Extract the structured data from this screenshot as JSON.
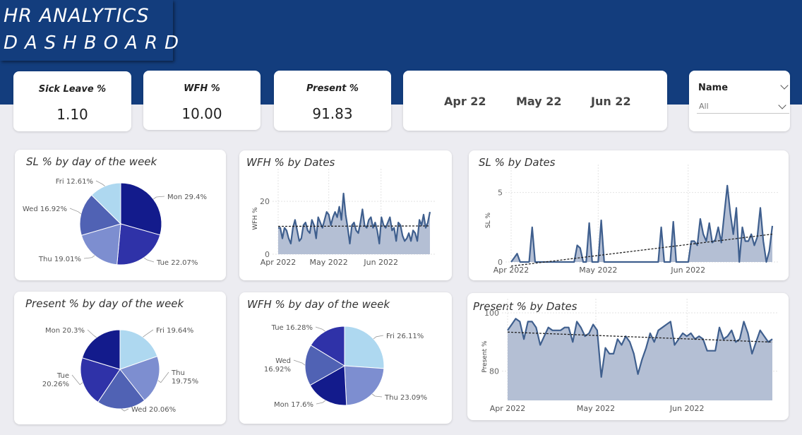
{
  "header": {
    "title_line1": "HR  ANALYTICS",
    "title_line2": "DASHBOARD"
  },
  "kpis": [
    {
      "label": "Sick Leave %",
      "value": "1.10"
    },
    {
      "label": "WFH %",
      "value": "10.00"
    },
    {
      "label": "Present %",
      "value": "91.83"
    }
  ],
  "months": [
    "Apr 22",
    "May 22",
    "Jun 22"
  ],
  "slicer": {
    "title": "Name",
    "value": "All"
  },
  "colors": {
    "header": "#133d7d",
    "line": "#3f5f8e",
    "area": "#b4bfd4",
    "pie": [
      "#131b8c",
      "#2f32a8",
      "#5062b4",
      "#7d8ed0",
      "#aed8f0"
    ]
  },
  "chart_data": [
    {
      "id": "sl-dow",
      "type": "pie",
      "title": "SL % by day of the week",
      "slices": [
        {
          "label": "Mon",
          "value": 29.4,
          "text": "Mon 29.4%"
        },
        {
          "label": "Tue",
          "value": 22.07,
          "text": "Tue 22.07%"
        },
        {
          "label": "Thu",
          "value": 19.01,
          "text": "Thu 19.01%"
        },
        {
          "label": "Wed",
          "value": 16.92,
          "text": "Wed 16.92%"
        },
        {
          "label": "Fri",
          "value": 12.61,
          "text": "Fri 12.61%"
        }
      ]
    },
    {
      "id": "wfh-dates",
      "type": "area",
      "title": "WFH % by Dates",
      "ylabel": "WFH %",
      "ylim": [
        0,
        27
      ],
      "yticks": [
        0,
        20
      ],
      "xticks": [
        "Apr 2022",
        "May 2022",
        "Jun 2022"
      ],
      "x_start": "2022-04-01",
      "x_end": "2022-06-30",
      "trendline": true,
      "values": [
        10,
        10,
        6,
        10,
        9,
        6,
        4,
        10,
        13,
        9,
        5,
        6,
        11,
        12,
        9,
        8,
        13,
        11,
        6,
        14,
        12,
        10,
        13,
        16,
        15,
        11,
        14,
        16,
        14,
        18,
        13,
        23,
        15,
        10,
        4,
        11,
        12,
        9,
        8,
        12,
        17,
        11,
        10,
        13,
        14,
        10,
        12,
        9,
        4,
        14,
        11,
        10,
        12,
        14,
        9,
        10,
        5,
        12,
        11,
        7,
        5,
        6,
        8,
        5,
        9,
        8,
        5,
        13,
        11,
        15,
        10,
        12,
        16
      ]
    },
    {
      "id": "sl-dates",
      "type": "area",
      "title": "SL % by Dates",
      "ylabel": "SL %",
      "ylim": [
        0,
        6
      ],
      "yticks": [
        0,
        5
      ],
      "xticks": [
        "Apr 2022",
        "May 2022",
        "Jun 2022"
      ],
      "x_start": "2022-04-01",
      "x_end": "2022-06-30",
      "trendline": true,
      "values": [
        0,
        0.3,
        0.6,
        0,
        0,
        0,
        0,
        2.5,
        0,
        0,
        0,
        0,
        0,
        0,
        0,
        0,
        0,
        0,
        0,
        0,
        0,
        0,
        1.2,
        1.0,
        0,
        0,
        2.8,
        0,
        0,
        0,
        3.0,
        0,
        0,
        0,
        0,
        0,
        0,
        0,
        0,
        0,
        0,
        0,
        0,
        0,
        0,
        0,
        0,
        0,
        0,
        0,
        2.5,
        0,
        0,
        0,
        2.9,
        0,
        0,
        0,
        0,
        0,
        1.5,
        1.5,
        1.2,
        3.1,
        2.0,
        1.5,
        2.8,
        1.4,
        1.6,
        2.5,
        1.4,
        3.5,
        5.5,
        3.5,
        2.0,
        3.9,
        0,
        2.5,
        1.5,
        1.5,
        2.0,
        1.2,
        1.8,
        3.9,
        1.5,
        0,
        0.8,
        2.6
      ]
    },
    {
      "id": "present-dow",
      "type": "pie",
      "title": "Present % by day of the week",
      "slices": [
        {
          "label": "Fri",
          "value": 19.64,
          "text": "Fri 19.64%"
        },
        {
          "label": "Thu",
          "value": 19.75,
          "text": [
            "Thu",
            "19.75%"
          ]
        },
        {
          "label": "Wed",
          "value": 20.06,
          "text": "Wed 20.06%"
        },
        {
          "label": "Tue",
          "value": 20.26,
          "text": [
            "Tue",
            "20.26%"
          ]
        },
        {
          "label": "Mon",
          "value": 20.3,
          "text": "Mon 20.3%"
        }
      ]
    },
    {
      "id": "wfh-dow",
      "type": "pie",
      "title": "WFH % by day of the week",
      "slices": [
        {
          "label": "Fri",
          "value": 26.11,
          "text": "Fri 26.11%"
        },
        {
          "label": "Thu",
          "value": 23.09,
          "text": "Thu 23.09%"
        },
        {
          "label": "Mon",
          "value": 17.6,
          "text": "Mon 17.6%"
        },
        {
          "label": "Wed",
          "value": 16.92,
          "text": [
            "Wed",
            "16.92%"
          ]
        },
        {
          "label": "Tue",
          "value": 16.28,
          "text": "Tue 16.28%"
        }
      ]
    },
    {
      "id": "present-dates",
      "type": "area",
      "title": "Present % by Dates",
      "ylabel": "Present %",
      "ylim": [
        70,
        100
      ],
      "yticks": [
        80,
        100
      ],
      "xticks": [
        "Apr 2022",
        "May 2022",
        "Jun 2022"
      ],
      "x_start": "2022-04-01",
      "x_end": "2022-06-30",
      "trendline": true,
      "values": [
        94,
        96,
        98,
        97,
        91,
        97,
        97,
        95,
        89,
        92,
        95,
        94,
        94,
        94,
        95,
        95,
        90,
        97,
        95,
        92,
        93,
        96,
        94,
        78,
        88,
        86,
        86,
        91,
        89,
        92,
        90,
        86,
        79,
        84,
        88,
        93,
        90,
        94,
        95,
        96,
        97,
        89,
        91,
        93,
        92,
        93,
        91,
        92,
        91,
        87,
        87,
        87,
        95,
        91,
        92,
        94,
        90,
        91,
        97,
        93,
        86,
        90,
        94,
        92,
        90,
        91
      ]
    }
  ]
}
